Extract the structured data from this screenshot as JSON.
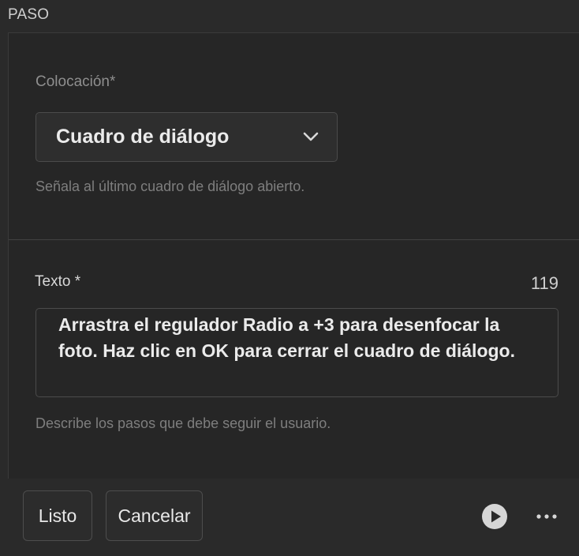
{
  "panel": {
    "title": "PASO"
  },
  "placement": {
    "label": "Colocación*",
    "selected": "Cuadro de diálogo",
    "helper": "Señala al último cuadro de diálogo abierto.",
    "icon": "chevron-down-icon"
  },
  "text_field": {
    "label": "Texto *",
    "counter": "119",
    "value": "Arrastra el regulador Radio a +3 para desenfocar la foto. Haz clic en OK para cerrar el cuadro de diálogo.",
    "helper": "Describe los pasos que debe seguir el usuario."
  },
  "footer": {
    "done_label": "Listo",
    "cancel_label": "Cancelar",
    "play_icon": "play-icon",
    "more_icon": "more-icon"
  },
  "colors": {
    "background": "#2a2a2a",
    "card": "#262626",
    "border": "#4b4b4b",
    "text_primary": "#ebebeb",
    "text_muted": "#7e7e7e"
  }
}
